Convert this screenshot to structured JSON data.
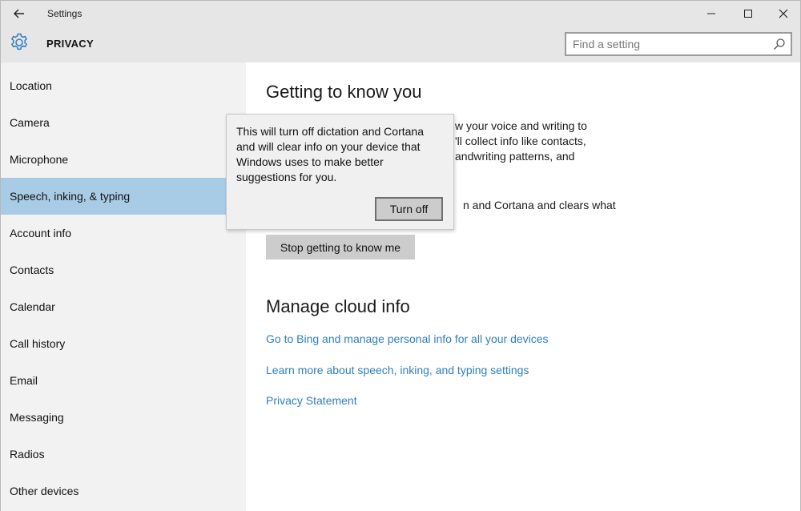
{
  "window": {
    "title": "Settings",
    "controls": {
      "minimize": "minimize-icon",
      "maximize": "maximize-icon",
      "close": "close-icon"
    }
  },
  "header": {
    "section": "PRIVACY",
    "icon": "gear-icon",
    "search_placeholder": "Find a setting"
  },
  "sidebar": {
    "items": [
      {
        "label": "Location"
      },
      {
        "label": "Camera"
      },
      {
        "label": "Microphone"
      },
      {
        "label": "Speech, inking, & typing",
        "selected": true
      },
      {
        "label": "Account info"
      },
      {
        "label": "Contacts"
      },
      {
        "label": "Calendar"
      },
      {
        "label": "Call history"
      },
      {
        "label": "Email"
      },
      {
        "label": "Messaging"
      },
      {
        "label": "Radios"
      },
      {
        "label": "Other devices"
      }
    ]
  },
  "main": {
    "heading1": "Getting to know you",
    "para1_lines": [
      "w your voice and writing to",
      "'ll collect info like contacts,",
      "andwriting patterns, and"
    ],
    "para2_line": "n and Cortana and clears what",
    "stop_button": "Stop getting to know me",
    "heading2": "Manage cloud info",
    "links": [
      "Go to Bing and manage personal info for all your devices",
      "Learn more about speech, inking, and typing settings",
      "Privacy Statement"
    ]
  },
  "flyout": {
    "lines": [
      "This will turn off dictation and Cortana",
      "and will clear info on your device that",
      "Windows uses to make better",
      "suggestions for you."
    ],
    "button": "Turn off"
  },
  "colors": {
    "chrome": "#e6e6e6",
    "sidebar": "#f2f2f2",
    "selected": "#a9cce6",
    "link": "#2f7fc1",
    "accent": "#2f7fc1"
  }
}
